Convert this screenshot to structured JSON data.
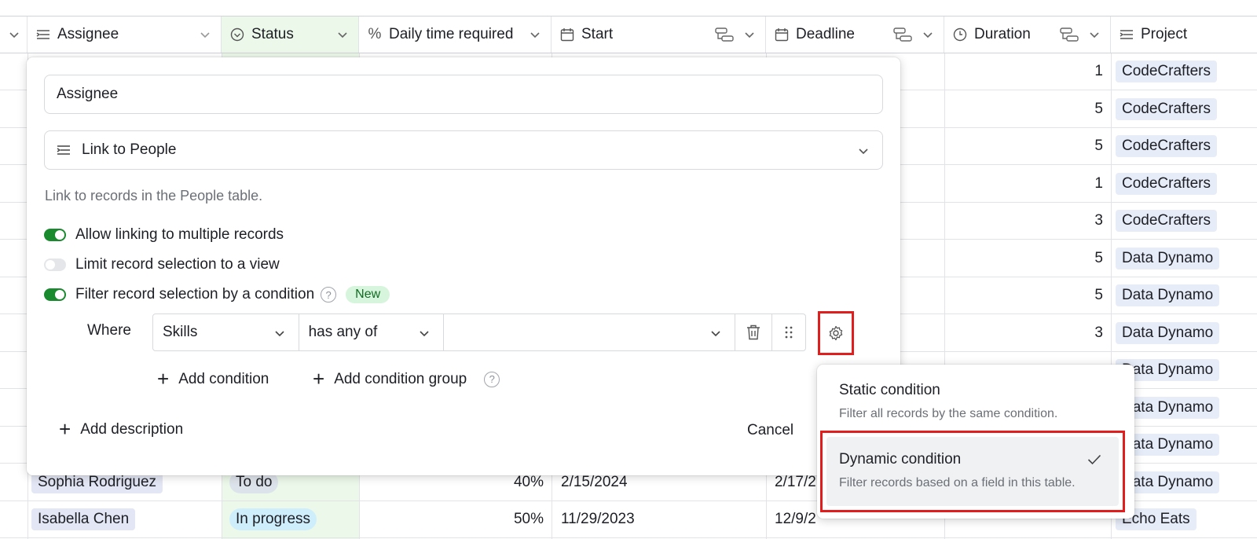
{
  "columns": [
    {
      "label": "Assignee",
      "icon": "link-icon"
    },
    {
      "label": "Status",
      "icon": "status-icon"
    },
    {
      "label": "Daily time required",
      "icon": "percent-icon"
    },
    {
      "label": "Start",
      "icon": "calendar-icon"
    },
    {
      "label": "Deadline",
      "icon": "calendar-icon"
    },
    {
      "label": "Duration",
      "icon": "clock-icon"
    },
    {
      "label": "Project",
      "icon": "link-icon"
    }
  ],
  "rows": [
    {
      "duration": "1",
      "project": "CodeCrafters"
    },
    {
      "duration": "5",
      "project": "CodeCrafters"
    },
    {
      "duration": "5",
      "project": "CodeCrafters"
    },
    {
      "duration": "1",
      "project": "CodeCrafters"
    },
    {
      "duration": "3",
      "project": "CodeCrafters"
    },
    {
      "duration": "5",
      "project": "Data Dynamo"
    },
    {
      "duration": "5",
      "project": "Data Dynamo"
    },
    {
      "duration": "3",
      "project": "Data Dynamo"
    },
    {
      "duration": "",
      "project": "Data Dynamo"
    },
    {
      "duration": "",
      "project": "Data Dynamo"
    },
    {
      "duration": "",
      "project": "Data Dynamo"
    },
    {
      "assignee": "Sophia Rodriguez",
      "status": "To do",
      "daily": "40%",
      "start": "2/15/2024",
      "deadline": "2/17/2",
      "duration": "",
      "project": "Data Dynamo"
    },
    {
      "assignee": "Isabella Chen",
      "status": "In progress",
      "daily": "50%",
      "start": "11/29/2023",
      "deadline": "12/9/2",
      "duration": "",
      "project": "Echo Eats"
    }
  ],
  "dialog": {
    "name_value": "Assignee",
    "field_type": "Link to People",
    "description": "Link to records in the People table.",
    "toggles": [
      {
        "label": "Allow linking to multiple records",
        "on": true
      },
      {
        "label": "Limit record selection to a view",
        "on": false
      },
      {
        "label": "Filter record selection by a condition",
        "on": true
      }
    ],
    "new_badge": "New",
    "where_label": "Where",
    "condition": {
      "field": "Skills",
      "operator": "has any of",
      "value": ""
    },
    "add_condition": "Add condition",
    "add_condition_group": "Add condition group",
    "add_description": "Add description",
    "cancel": "Cancel"
  },
  "popover": {
    "options": [
      {
        "title": "Static condition",
        "desc": "Filter all records by the same condition.",
        "selected": false
      },
      {
        "title": "Dynamic condition",
        "desc": "Filter records based on a field in this table.",
        "selected": true
      }
    ]
  },
  "colors": {
    "accent_green": "#1a8a2e",
    "highlight_red": "#e01e1e",
    "status_column_bg": "#ecf8ea"
  }
}
